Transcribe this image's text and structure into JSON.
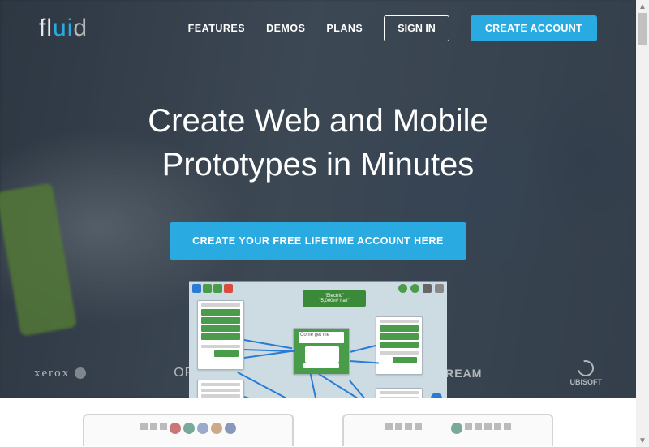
{
  "brand": {
    "name": "fluid"
  },
  "nav": {
    "features": "FEATURES",
    "demos": "DEMOS",
    "plans": "PLANS",
    "signin": "SIGN IN",
    "create_account": "CREATE ACCOUNT"
  },
  "hero": {
    "title_line1": "Create Web and Mobile",
    "title_line2": "Prototypes in Minutes",
    "cta": "CREATE YOUR FREE LIFETIME ACCOUNT HERE"
  },
  "preview": {
    "tooltip_label": "\"Electric\"",
    "tooltip_line2": "\"5,000m² hall\"",
    "center_card_label": "Come get me"
  },
  "clients": {
    "xerox": "xerox",
    "oracle": "ORACLE",
    "ustream": "USTREAM",
    "ubisoft": "UBISOFT"
  },
  "colors": {
    "accent": "#29abe2",
    "green": "#4a9c4a",
    "link_line": "#2a7bd4"
  }
}
